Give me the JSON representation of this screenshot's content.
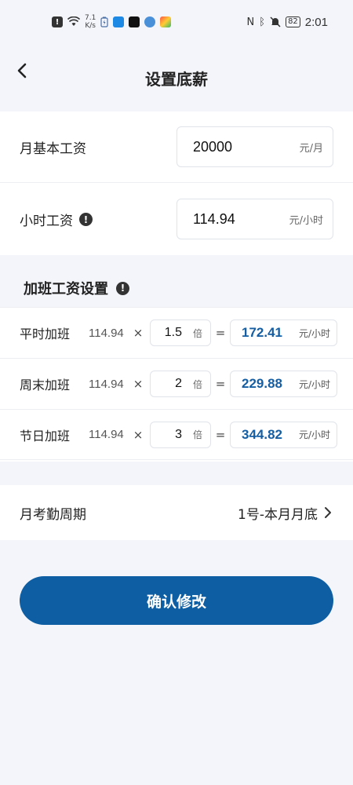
{
  "statusbar": {
    "speed_value": "7.1",
    "speed_unit": "K/s",
    "battery": "82",
    "time": "2:01"
  },
  "header": {
    "title": "设置底薪"
  },
  "salary": {
    "monthly_label": "月基本工资",
    "monthly_value": "20000",
    "monthly_unit": "元/月",
    "hourly_label": "小时工资",
    "hourly_value": "114.94",
    "hourly_unit": "元/小时"
  },
  "overtime": {
    "section_title": "加班工资设置",
    "times_symbol": "×",
    "equals_symbol": "=",
    "multiplier_unit": "倍",
    "result_unit": "元/小时",
    "rows": [
      {
        "label": "平时加班",
        "base": "114.94",
        "multiplier": "1.5",
        "result": "172.41"
      },
      {
        "label": "周末加班",
        "base": "114.94",
        "multiplier": "2",
        "result": "229.88"
      },
      {
        "label": "节日加班",
        "base": "114.94",
        "multiplier": "3",
        "result": "344.82"
      }
    ]
  },
  "period": {
    "label": "月考勤周期",
    "value": "1号-本月月底"
  },
  "confirm_label": "确认修改",
  "colors": {
    "primary": "#0d5ea3",
    "result_text": "#155ea3",
    "background": "#f3f5fa"
  }
}
